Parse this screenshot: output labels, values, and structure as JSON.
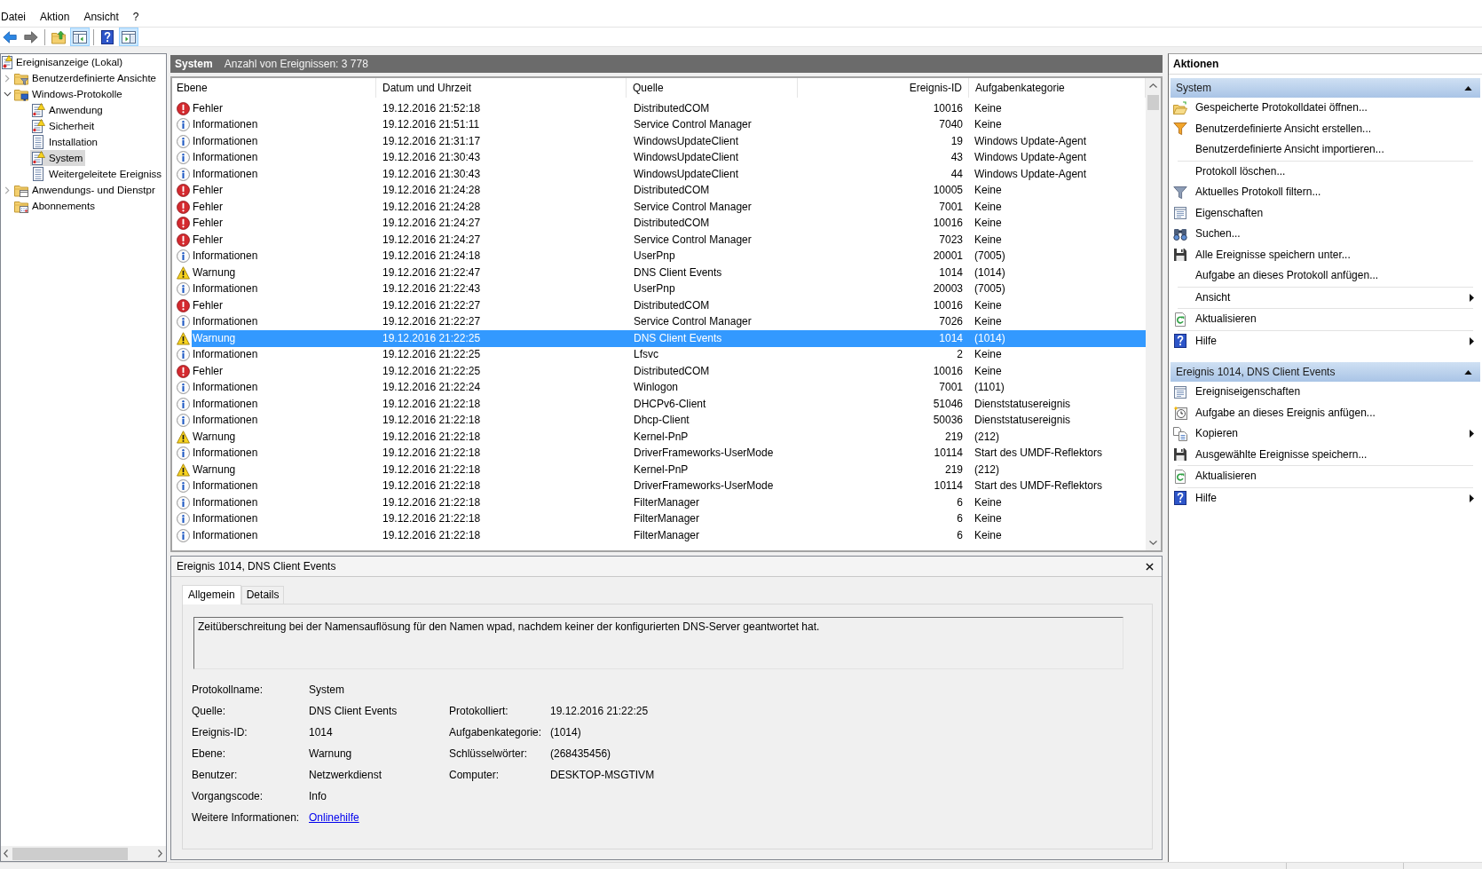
{
  "menu": [
    "Datei",
    "Aktion",
    "Ansicht",
    "?"
  ],
  "toolbar": [
    {
      "kind": "back",
      "pressed": false,
      "disabled": false
    },
    {
      "kind": "forward",
      "pressed": false,
      "disabled": true
    },
    {
      "kind": "separator"
    },
    {
      "kind": "up",
      "pressed": false,
      "disabled": false
    },
    {
      "kind": "console-tree",
      "pressed": true,
      "disabled": false
    },
    {
      "kind": "separator"
    },
    {
      "kind": "help",
      "pressed": false,
      "disabled": false
    },
    {
      "kind": "action-pane",
      "pressed": true,
      "disabled": false
    }
  ],
  "tree": [
    {
      "label": "Ereignisanzeige (Lokal)",
      "kind": "root",
      "selected": false,
      "children": [
        {
          "label": "Benutzerdefinierte Ansichte",
          "kind": "custom-views",
          "expanded": false,
          "selected": false
        },
        {
          "label": "Windows-Protokolle",
          "kind": "windows-logs",
          "expanded": true,
          "selected": false,
          "children": [
            {
              "label": "Anwendung",
              "kind": "log-warning",
              "selected": false
            },
            {
              "label": "Sicherheit",
              "kind": "log-warning",
              "selected": false
            },
            {
              "label": "Installation",
              "kind": "log",
              "selected": false
            },
            {
              "label": "System",
              "kind": "log-warning",
              "selected": true
            },
            {
              "label": "Weitergeleitete Ereigniss",
              "kind": "log",
              "selected": false
            }
          ]
        },
        {
          "label": "Anwendungs- und Dienstpr",
          "kind": "services-logs",
          "expanded": false,
          "selected": false
        },
        {
          "label": "Abonnements",
          "kind": "subscriptions",
          "selected": false
        }
      ]
    }
  ],
  "log_header": {
    "title": "System",
    "count": "Anzahl von Ereignissen: 3 778"
  },
  "table": {
    "columns": [
      "Ebene",
      "Datum und Uhrzeit",
      "Quelle",
      "Ereignis-ID",
      "Aufgabenkategorie"
    ],
    "rows": [
      {
        "kind": "error",
        "selected": false,
        "cells": [
          "Fehler",
          "19.12.2016 21:52:18",
          "DistributedCOM",
          "10016",
          "Keine"
        ]
      },
      {
        "kind": "info",
        "selected": false,
        "cells": [
          "Informationen",
          "19.12.2016 21:51:11",
          "Service Control Manager",
          "7040",
          "Keine"
        ]
      },
      {
        "kind": "info",
        "selected": false,
        "cells": [
          "Informationen",
          "19.12.2016 21:31:17",
          "WindowsUpdateClient",
          "19",
          "Windows Update-Agent"
        ]
      },
      {
        "kind": "info",
        "selected": false,
        "cells": [
          "Informationen",
          "19.12.2016 21:30:43",
          "WindowsUpdateClient",
          "43",
          "Windows Update-Agent"
        ]
      },
      {
        "kind": "info",
        "selected": false,
        "cells": [
          "Informationen",
          "19.12.2016 21:30:43",
          "WindowsUpdateClient",
          "44",
          "Windows Update-Agent"
        ]
      },
      {
        "kind": "error",
        "selected": false,
        "cells": [
          "Fehler",
          "19.12.2016 21:24:28",
          "DistributedCOM",
          "10005",
          "Keine"
        ]
      },
      {
        "kind": "error",
        "selected": false,
        "cells": [
          "Fehler",
          "19.12.2016 21:24:28",
          "Service Control Manager",
          "7001",
          "Keine"
        ]
      },
      {
        "kind": "error",
        "selected": false,
        "cells": [
          "Fehler",
          "19.12.2016 21:24:27",
          "DistributedCOM",
          "10016",
          "Keine"
        ]
      },
      {
        "kind": "error",
        "selected": false,
        "cells": [
          "Fehler",
          "19.12.2016 21:24:27",
          "Service Control Manager",
          "7023",
          "Keine"
        ]
      },
      {
        "kind": "info",
        "selected": false,
        "cells": [
          "Informationen",
          "19.12.2016 21:24:18",
          "UserPnp",
          "20001",
          "(7005)"
        ]
      },
      {
        "kind": "warning",
        "selected": false,
        "cells": [
          "Warnung",
          "19.12.2016 21:22:47",
          "DNS Client Events",
          "1014",
          "(1014)"
        ]
      },
      {
        "kind": "info",
        "selected": false,
        "cells": [
          "Informationen",
          "19.12.2016 21:22:43",
          "UserPnp",
          "20003",
          "(7005)"
        ]
      },
      {
        "kind": "error",
        "selected": false,
        "cells": [
          "Fehler",
          "19.12.2016 21:22:27",
          "DistributedCOM",
          "10016",
          "Keine"
        ]
      },
      {
        "kind": "info",
        "selected": false,
        "cells": [
          "Informationen",
          "19.12.2016 21:22:27",
          "Service Control Manager",
          "7026",
          "Keine"
        ]
      },
      {
        "kind": "warning",
        "selected": true,
        "cells": [
          "Warnung",
          "19.12.2016 21:22:25",
          "DNS Client Events",
          "1014",
          "(1014)"
        ]
      },
      {
        "kind": "info",
        "selected": false,
        "cells": [
          "Informationen",
          "19.12.2016 21:22:25",
          "Lfsvc",
          "2",
          "Keine"
        ]
      },
      {
        "kind": "error",
        "selected": false,
        "cells": [
          "Fehler",
          "19.12.2016 21:22:25",
          "DistributedCOM",
          "10016",
          "Keine"
        ]
      },
      {
        "kind": "info",
        "selected": false,
        "cells": [
          "Informationen",
          "19.12.2016 21:22:24",
          "Winlogon",
          "7001",
          "(1101)"
        ]
      },
      {
        "kind": "info",
        "selected": false,
        "cells": [
          "Informationen",
          "19.12.2016 21:22:18",
          "DHCPv6-Client",
          "51046",
          "Dienststatusereignis"
        ]
      },
      {
        "kind": "info",
        "selected": false,
        "cells": [
          "Informationen",
          "19.12.2016 21:22:18",
          "Dhcp-Client",
          "50036",
          "Dienststatusereignis"
        ]
      },
      {
        "kind": "warning",
        "selected": false,
        "cells": [
          "Warnung",
          "19.12.2016 21:22:18",
          "Kernel-PnP",
          "219",
          "(212)"
        ]
      },
      {
        "kind": "info",
        "selected": false,
        "cells": [
          "Informationen",
          "19.12.2016 21:22:18",
          "DriverFrameworks-UserMode",
          "10114",
          "Start des UMDF-Reflektors"
        ]
      },
      {
        "kind": "warning",
        "selected": false,
        "cells": [
          "Warnung",
          "19.12.2016 21:22:18",
          "Kernel-PnP",
          "219",
          "(212)"
        ]
      },
      {
        "kind": "info",
        "selected": false,
        "cells": [
          "Informationen",
          "19.12.2016 21:22:18",
          "DriverFrameworks-UserMode",
          "10114",
          "Start des UMDF-Reflektors"
        ]
      },
      {
        "kind": "info",
        "selected": false,
        "cells": [
          "Informationen",
          "19.12.2016 21:22:18",
          "FilterManager",
          "6",
          "Keine"
        ]
      },
      {
        "kind": "info",
        "selected": false,
        "cells": [
          "Informationen",
          "19.12.2016 21:22:18",
          "FilterManager",
          "6",
          "Keine"
        ]
      },
      {
        "kind": "info",
        "selected": false,
        "cells": [
          "Informationen",
          "19.12.2016 21:22:18",
          "FilterManager",
          "6",
          "Keine"
        ]
      }
    ]
  },
  "details": {
    "title": "Ereignis 1014, DNS Client Events",
    "tabs": [
      {
        "label": "Allgemein",
        "selected": true
      },
      {
        "label": "Details",
        "selected": false
      }
    ],
    "message": "Zeitüberschreitung bei der Namensauflösung für den Namen wpad, nachdem keiner der konfigurierten DNS-Server geantwortet hat.",
    "fields": [
      [
        {
          "label": "Protokollname:",
          "value": "System",
          "kind": "text"
        }
      ],
      [
        {
          "label": "Quelle:",
          "value": "DNS Client Events",
          "kind": "text"
        },
        {
          "label": "Protokolliert:",
          "value": "19.12.2016 21:22:25",
          "kind": "text"
        }
      ],
      [
        {
          "label": "Ereignis-ID:",
          "value": "1014",
          "kind": "text"
        },
        {
          "label": "Aufgabenkategorie:",
          "value": "(1014)",
          "kind": "text"
        }
      ],
      [
        {
          "label": "Ebene:",
          "value": "Warnung",
          "kind": "text"
        },
        {
          "label": "Schlüsselwörter:",
          "value": "(268435456)",
          "kind": "text"
        }
      ],
      [
        {
          "label": "Benutzer:",
          "value": "Netzwerkdienst",
          "kind": "text"
        },
        {
          "label": "Computer:",
          "value": "DESKTOP-MSGTIVM",
          "kind": "text"
        }
      ],
      [
        {
          "label": "Vorgangscode:",
          "value": "Info",
          "kind": "text"
        }
      ],
      [
        {
          "label": "Weitere Informationen:",
          "value": "Onlinehilfe",
          "kind": "link"
        }
      ]
    ]
  },
  "actions": {
    "title": "Aktionen",
    "sections": [
      {
        "title": "System",
        "expanded": true,
        "items": [
          {
            "kind": "open",
            "label": "Gespeicherte Protokolldatei öffnen...",
            "submenu": false
          },
          {
            "kind": "create-view",
            "label": "Benutzerdefinierte Ansicht erstellen...",
            "submenu": false
          },
          {
            "kind": "plain",
            "label": "Benutzerdefinierte Ansicht importieren...",
            "submenu": false
          },
          {
            "kind": "separator"
          },
          {
            "kind": "plain",
            "label": "Protokoll löschen...",
            "submenu": false
          },
          {
            "kind": "filter",
            "label": "Aktuelles Protokoll filtern...",
            "submenu": false
          },
          {
            "kind": "properties",
            "label": "Eigenschaften",
            "submenu": false
          },
          {
            "kind": "find",
            "label": "Suchen...",
            "submenu": false
          },
          {
            "kind": "save",
            "label": "Alle Ereignisse speichern unter...",
            "submenu": false
          },
          {
            "kind": "plain",
            "label": "Aufgabe an dieses Protokoll anfügen...",
            "submenu": false
          },
          {
            "kind": "separator"
          },
          {
            "kind": "plain",
            "label": "Ansicht",
            "submenu": true
          },
          {
            "kind": "separator"
          },
          {
            "kind": "refresh",
            "label": "Aktualisieren",
            "submenu": false
          },
          {
            "kind": "separator"
          },
          {
            "kind": "help",
            "label": "Hilfe",
            "submenu": true
          }
        ]
      },
      {
        "title": "Ereignis 1014, DNS Client Events",
        "expanded": true,
        "items": [
          {
            "kind": "properties",
            "label": "Ereigniseigenschaften",
            "submenu": false
          },
          {
            "kind": "attach-task",
            "label": "Aufgabe an dieses Ereignis anfügen...",
            "submenu": false
          },
          {
            "kind": "copy",
            "label": "Kopieren",
            "submenu": true
          },
          {
            "kind": "save",
            "label": "Ausgewählte Ereignisse speichern...",
            "submenu": false
          },
          {
            "kind": "separator"
          },
          {
            "kind": "refresh",
            "label": "Aktualisieren",
            "submenu": false
          },
          {
            "kind": "separator"
          },
          {
            "kind": "help",
            "label": "Hilfe",
            "submenu": true
          }
        ]
      }
    ]
  }
}
